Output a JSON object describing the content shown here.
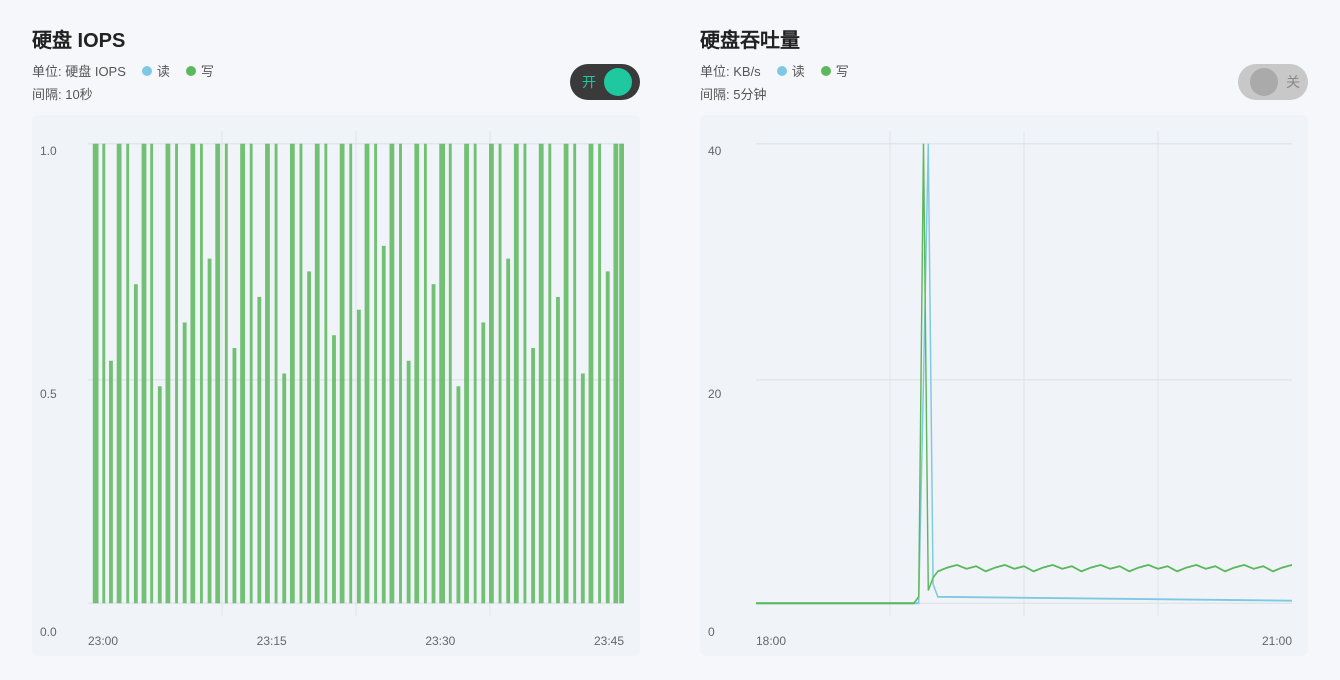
{
  "left_panel": {
    "title": "硬盘 IOPS",
    "unit_label": "单位: 硬盘 IOPS",
    "interval_label": "间隔: 10秒",
    "read_label": "读",
    "write_label": "写",
    "toggle_on_label": "开",
    "toggle_state": "on",
    "x_labels": [
      "23:00",
      "23:15",
      "23:30",
      "23:45"
    ],
    "y_labels": [
      "1.0",
      "0.5",
      "0.0"
    ]
  },
  "right_panel": {
    "title": "硬盘吞吐量",
    "unit_label": "单位: KB/s",
    "interval_label": "间隔: 5分钟",
    "read_label": "读",
    "write_label": "写",
    "toggle_off_label": "关",
    "toggle_state": "off",
    "x_labels": [
      "18:00",
      "21:00"
    ],
    "y_labels": [
      "40",
      "20",
      "0"
    ]
  }
}
